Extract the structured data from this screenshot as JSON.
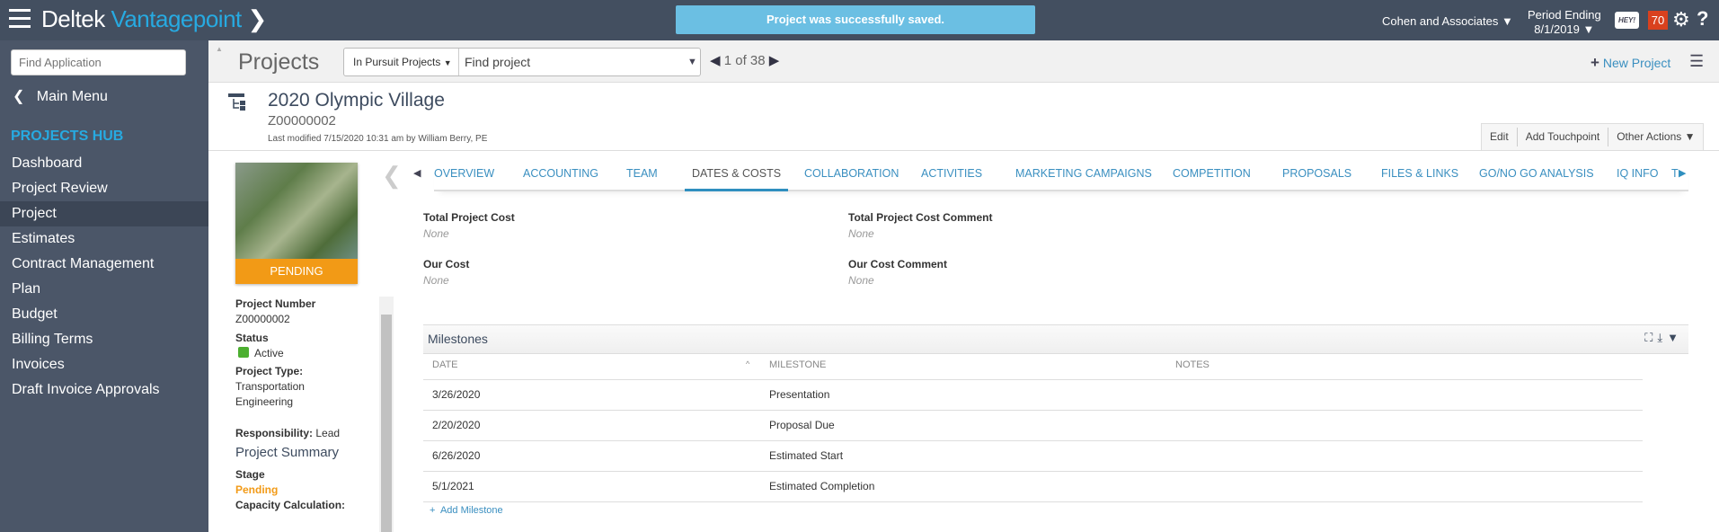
{
  "topbar": {
    "brand_a": "Deltek",
    "brand_b": "Vantagepoint",
    "toast": "Project was successfully saved.",
    "company": "Cohen and Associates",
    "period_label": "Period Ending",
    "period_value": "8/1/2019",
    "hey": "HEY!",
    "notifications": "70"
  },
  "sidebar": {
    "search_placeholder": "Find Application",
    "main_menu": "Main Menu",
    "hub": "PROJECTS HUB",
    "items": [
      "Dashboard",
      "Project Review",
      "Project",
      "Estimates",
      "Contract Management",
      "Plan",
      "Budget",
      "Billing Terms",
      "Invoices",
      "Draft Invoice Approvals"
    ],
    "active": "Project"
  },
  "subbar": {
    "title": "Projects",
    "filter": "In Pursuit Projects",
    "find_placeholder": "Find project",
    "pager_current": "1",
    "pager_of": "of",
    "pager_total": "38",
    "new_project": "New Project"
  },
  "record": {
    "title": "2020 Olympic Village",
    "number": "Z00000002",
    "modified": "Last modified 7/15/2020 10:31 am by William Berry, PE",
    "actions": [
      "Edit",
      "Add Touchpoint",
      "Other Actions"
    ],
    "stage_badge": "PENDING"
  },
  "info": {
    "project_number_label": "Project Number",
    "project_number": "Z00000002",
    "status_label": "Status",
    "status": "Active",
    "status_color": "#4caf30",
    "type_label": "Project Type:",
    "type": "Transportation Engineering",
    "responsibility_label": "Responsibility:",
    "responsibility": "Lead",
    "summary": "Project Summary",
    "stage_label": "Stage",
    "stage": "Pending",
    "stage_color": "#f29a16",
    "capacity_label": "Capacity Calculation:"
  },
  "tabs": [
    "OVERVIEW",
    "ACCOUNTING",
    "TEAM",
    "DATES & COSTS",
    "COLLABORATION",
    "ACTIVITIES",
    "MARKETING CAMPAIGNS",
    "COMPETITION",
    "PROPOSALS",
    "FILES & LINKS",
    "GO/NO GO ANALYSIS",
    "IQ INFO",
    "T"
  ],
  "active_tab": "DATES & COSTS",
  "fields": {
    "total_cost_label": "Total Project Cost",
    "total_cost": "None",
    "total_cost_comment_label": "Total Project Cost Comment",
    "total_cost_comment": "None",
    "our_cost_label": "Our Cost",
    "our_cost": "None",
    "our_cost_comment_label": "Our Cost Comment",
    "our_cost_comment": "None"
  },
  "milestones": {
    "title": "Milestones",
    "columns": [
      "DATE",
      "MILESTONE",
      "NOTES"
    ],
    "rows": [
      {
        "date": "3/26/2020",
        "milestone": "Presentation",
        "notes": ""
      },
      {
        "date": "2/20/2020",
        "milestone": "Proposal Due",
        "notes": ""
      },
      {
        "date": "6/26/2020",
        "milestone": "Estimated Start",
        "notes": ""
      },
      {
        "date": "5/1/2021",
        "milestone": "Estimated Completion",
        "notes": ""
      }
    ],
    "add": "Add Milestone"
  }
}
